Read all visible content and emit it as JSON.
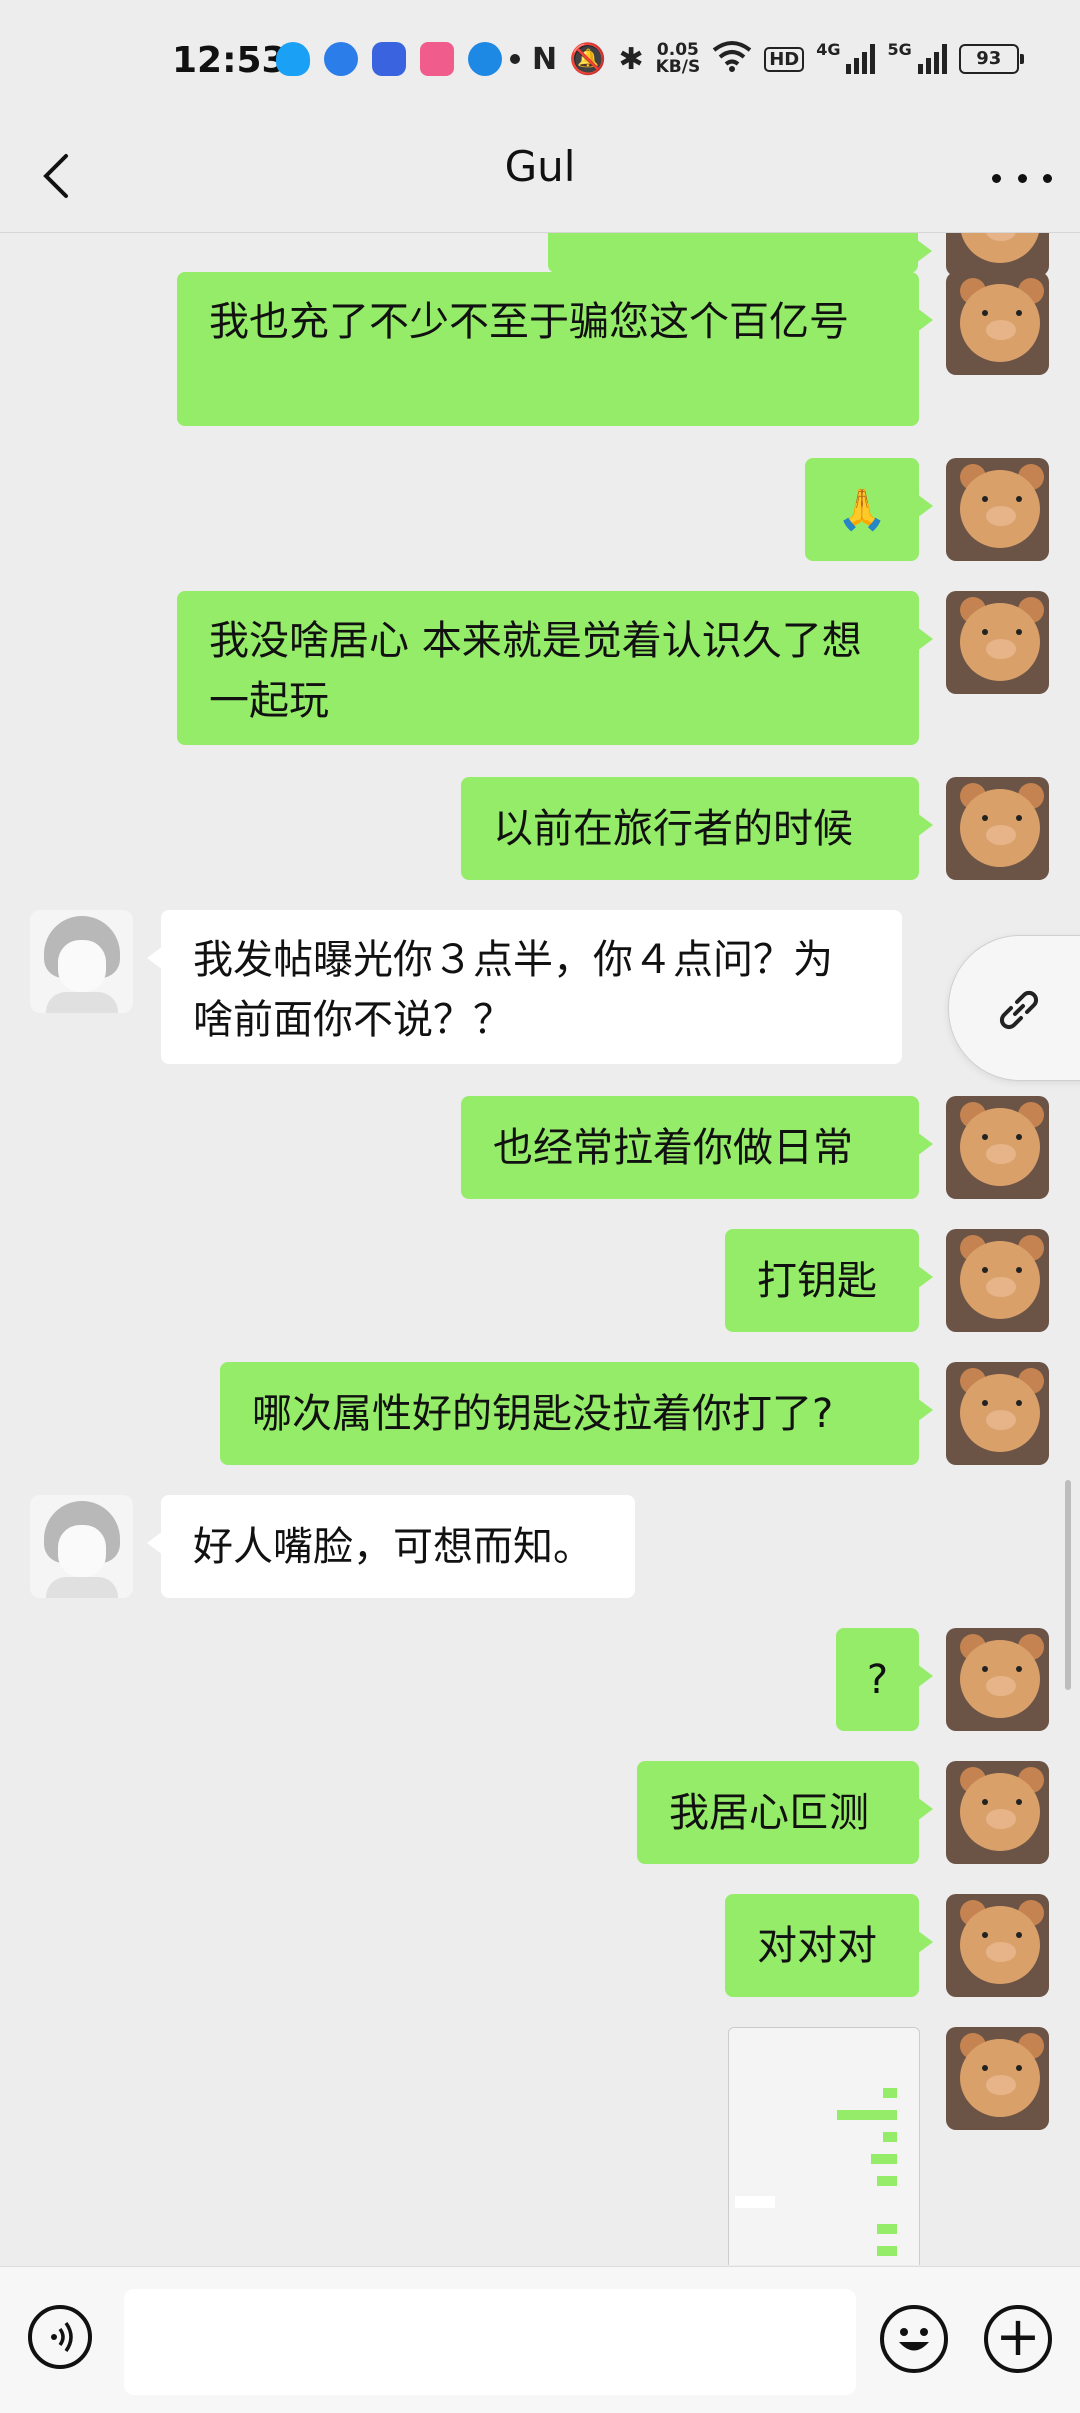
{
  "status_bar": {
    "time": "12:53",
    "net_speed_value": "0.05",
    "net_speed_unit": "KB/S",
    "hd_label": "HD",
    "sim1_label": "4G",
    "sim2_label": "5G",
    "battery": "93"
  },
  "header": {
    "title": "Gul"
  },
  "messages": [
    {
      "side": "right",
      "text": "我也充了不少不至于骗您这个百亿号"
    },
    {
      "side": "right",
      "text": "🙏"
    },
    {
      "side": "right",
      "text": "我没啥居心 本来就是觉着认识久了想一起玩"
    },
    {
      "side": "right",
      "text": "以前在旅行者的时候"
    },
    {
      "side": "left",
      "text": "我发帖曝光你３点半，你４点问？为啥前面你不说？？"
    },
    {
      "side": "right",
      "text": "也经常拉着你做日常"
    },
    {
      "side": "right",
      "text": "打钥匙"
    },
    {
      "side": "right",
      "text": "哪次属性好的钥匙没拉着你打了?"
    },
    {
      "side": "left",
      "text": "好人嘴脸，可想而知。"
    },
    {
      "side": "right",
      "text": "?"
    },
    {
      "side": "right",
      "text": "我居心叵测"
    },
    {
      "side": "right",
      "text": "对对对"
    }
  ],
  "colors": {
    "outgoing_bubble": "#95ec69",
    "incoming_bubble": "#ffffff",
    "background": "#ededed"
  },
  "icons": [
    "back-arrow-icon",
    "more-dots-icon",
    "link-icon",
    "voice-icon",
    "emoji-icon",
    "plus-icon"
  ]
}
